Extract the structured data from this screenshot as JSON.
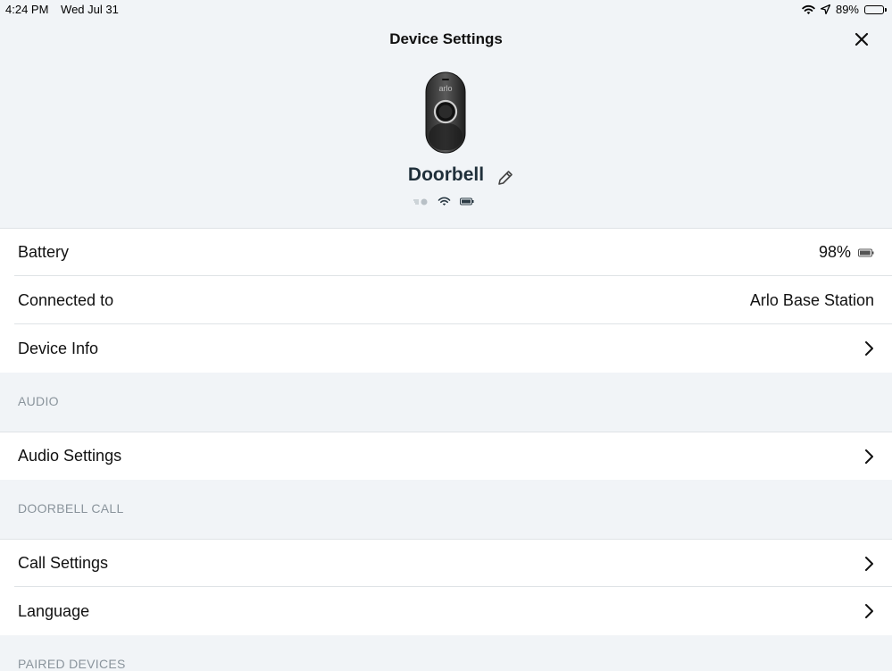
{
  "status_bar": {
    "time": "4:24 PM",
    "date": "Wed Jul 31",
    "battery_percent": "89%",
    "battery_level": 0.89,
    "icons": [
      "wifi-icon",
      "location-arrow-icon",
      "battery-icon"
    ]
  },
  "nav": {
    "title": "Device Settings",
    "close_icon": "close-icon"
  },
  "device": {
    "name": "Doorbell",
    "brand_mark": "arlo",
    "edit_icon": "pencil-icon",
    "status_icons": [
      "motion-icon",
      "wifi-icon",
      "battery-icon"
    ]
  },
  "rows": {
    "battery": {
      "label": "Battery",
      "value": "98%",
      "level": 0.98
    },
    "connected": {
      "label": "Connected to",
      "value": "Arlo Base Station"
    },
    "device_info": {
      "label": "Device Info"
    }
  },
  "sections": {
    "audio": {
      "header": "AUDIO",
      "items": [
        {
          "label": "Audio Settings"
        }
      ]
    },
    "doorbell_call": {
      "header": "DOORBELL CALL",
      "items": [
        {
          "label": "Call Settings"
        },
        {
          "label": "Language"
        }
      ]
    },
    "paired_devices": {
      "header": "PAIRED DEVICES"
    }
  },
  "colors": {
    "background": "#f1f4f7",
    "row_background": "#ffffff",
    "section_text": "#8a949c",
    "title_text": "#1f2f3a"
  }
}
